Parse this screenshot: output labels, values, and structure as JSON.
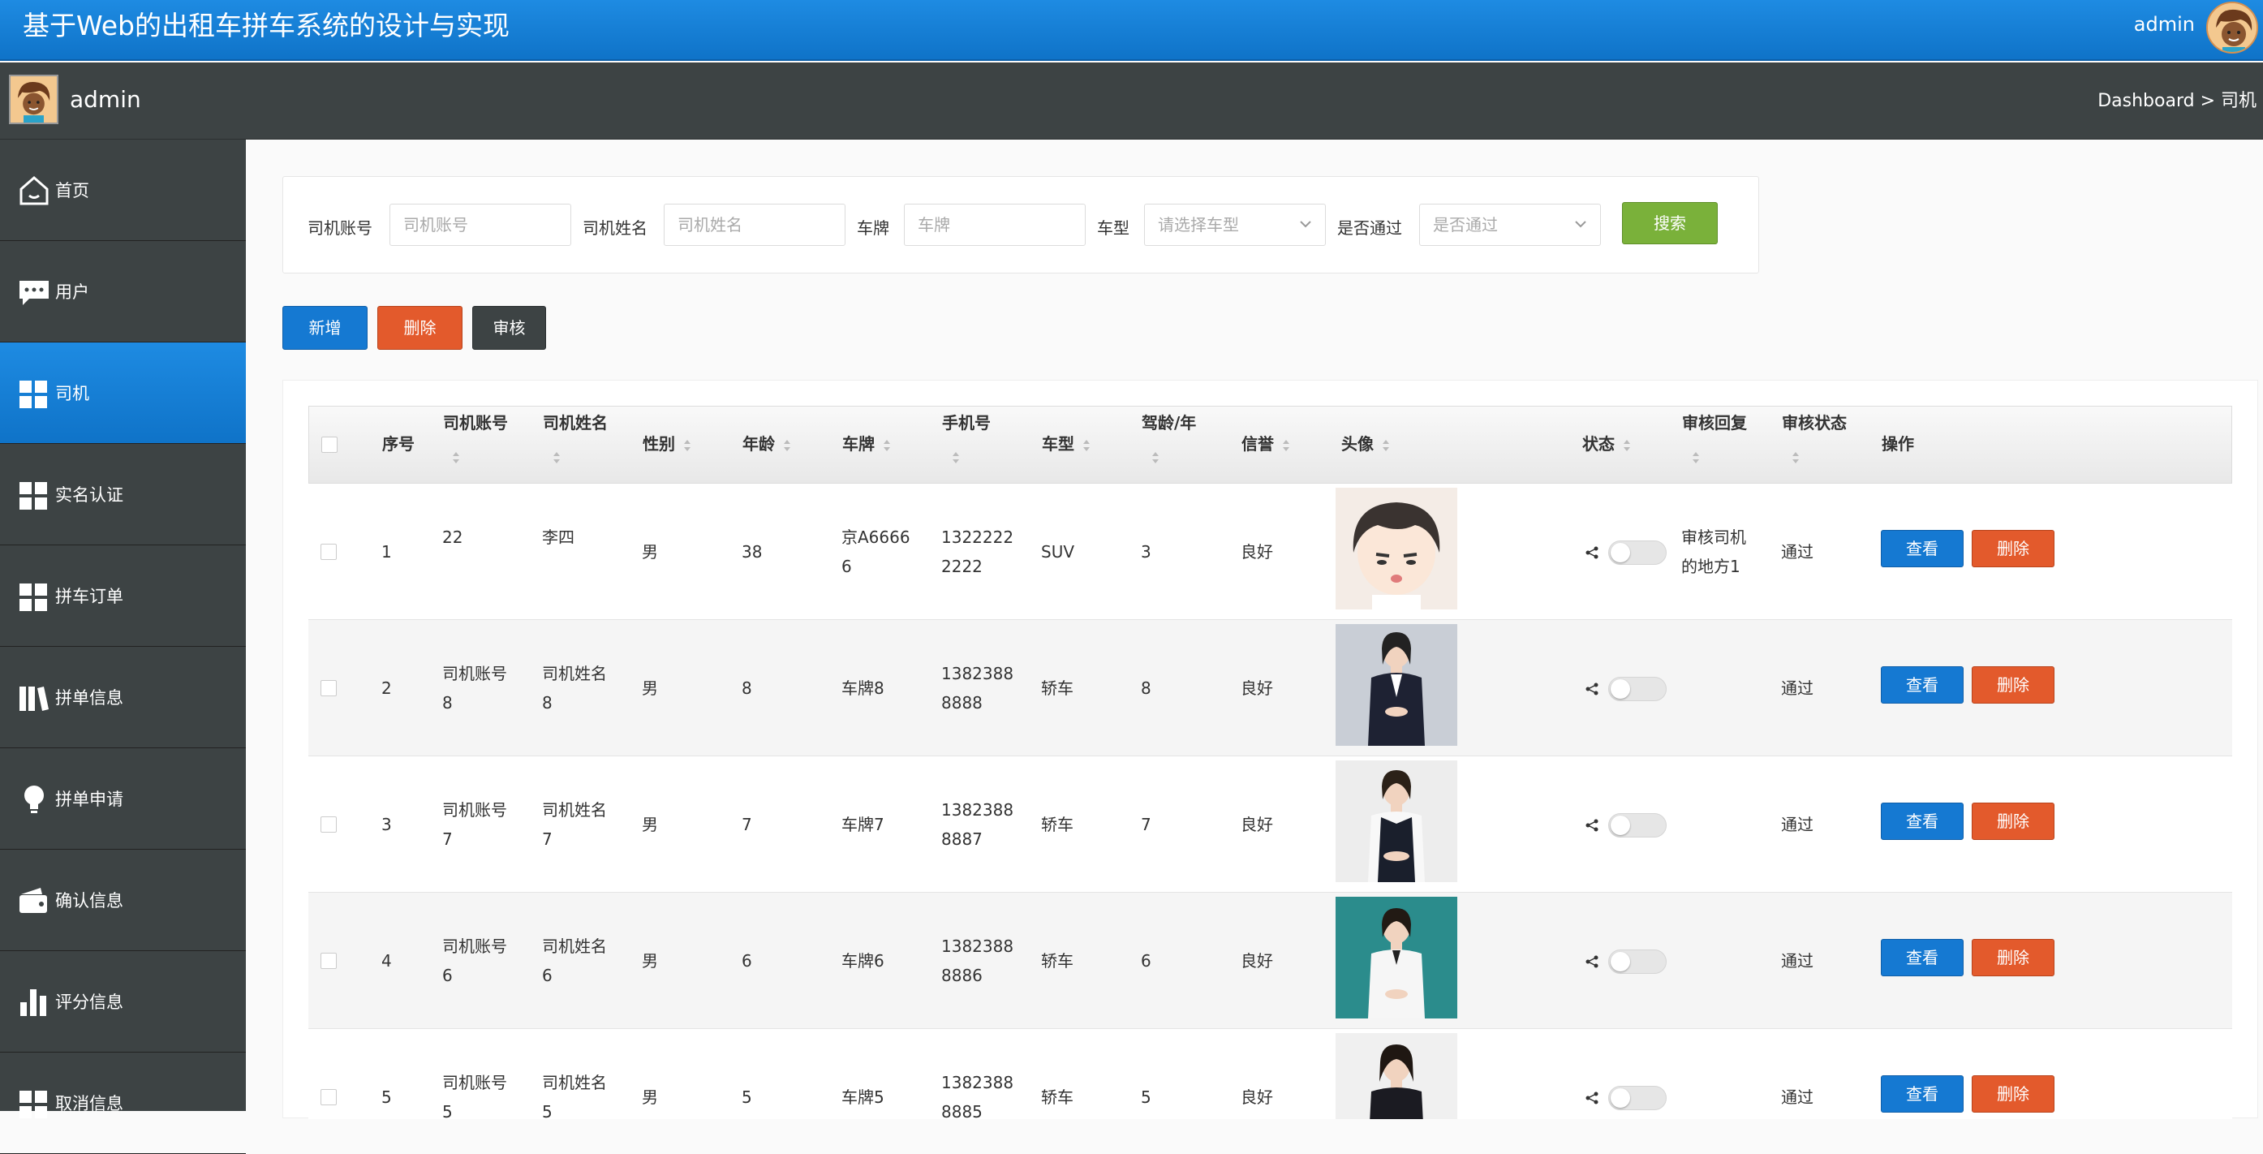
{
  "app": {
    "title": "基于Web的出租车拼车系统的设计与实现",
    "user": "admin"
  },
  "subbar": {
    "user": "admin",
    "breadcrumb": "Dashboard > 司机"
  },
  "sidebar": {
    "items": [
      {
        "label": "首页",
        "icon": "home-icon"
      },
      {
        "label": "用户",
        "icon": "chat-icon"
      },
      {
        "label": "司机",
        "icon": "grid-icon",
        "active": true
      },
      {
        "label": "实名认证",
        "icon": "grid-icon"
      },
      {
        "label": "拼车订单",
        "icon": "grid-icon"
      },
      {
        "label": "拼单信息",
        "icon": "book-icon"
      },
      {
        "label": "拼单申请",
        "icon": "bulb-icon"
      },
      {
        "label": "确认信息",
        "icon": "wallet-icon"
      },
      {
        "label": "评分信息",
        "icon": "bar-chart-icon"
      },
      {
        "label": "取消信息",
        "icon": "grid-icon"
      }
    ]
  },
  "search": {
    "account_label": "司机账号",
    "account_placeholder": "司机账号",
    "name_label": "司机姓名",
    "name_placeholder": "司机姓名",
    "plate_label": "车牌",
    "plate_placeholder": "车牌",
    "type_label": "车型",
    "type_placeholder": "请选择车型",
    "pass_label": "是否通过",
    "pass_placeholder": "是否通过",
    "search_button": "搜索"
  },
  "actions": {
    "add": "新增",
    "delete": "删除",
    "audit": "审核"
  },
  "table": {
    "headers": {
      "index": "序号",
      "account": "司机账号",
      "name": "司机姓名",
      "gender": "性别",
      "age": "年龄",
      "plate": "车牌",
      "phone": "手机号",
      "type": "车型",
      "years": "驾龄/年",
      "credit": "信誉",
      "avatar": "头像",
      "status": "状态",
      "reply": "审核回复",
      "audit": "审核状态",
      "ops": "操作"
    },
    "view_label": "查看",
    "delete_label": "删除",
    "rows": [
      {
        "index": "1",
        "account_l1": "22",
        "account_l2": "",
        "name_l1": "李四",
        "name_l2": "",
        "gender": "男",
        "age": "38",
        "plate_l1": "京A6666",
        "plate_l2": "6",
        "phone_l1": "1322222",
        "phone_l2": "2222",
        "type": "SUV",
        "years": "3",
        "credit": "良好",
        "reply_l1": "审核司机",
        "reply_l2": "的地方1",
        "audit": "通过",
        "photo": "cartoon-boy"
      },
      {
        "index": "2",
        "account_l1": "司机账号",
        "account_l2": "8",
        "name_l1": "司机姓名",
        "name_l2": "8",
        "gender": "男",
        "age": "8",
        "plate_l1": "车牌8",
        "plate_l2": "",
        "phone_l1": "1382388",
        "phone_l2": "8888",
        "type": "轿车",
        "years": "8",
        "credit": "良好",
        "reply_l1": "",
        "reply_l2": "",
        "audit": "通过",
        "photo": "woman-dark-suit"
      },
      {
        "index": "3",
        "account_l1": "司机账号",
        "account_l2": "7",
        "name_l1": "司机姓名",
        "name_l2": "7",
        "gender": "男",
        "age": "7",
        "plate_l1": "车牌7",
        "plate_l2": "",
        "phone_l1": "1382388",
        "phone_l2": "8887",
        "type": "轿车",
        "years": "7",
        "credit": "良好",
        "reply_l1": "",
        "reply_l2": "",
        "audit": "通过",
        "photo": "woman-vest"
      },
      {
        "index": "4",
        "account_l1": "司机账号",
        "account_l2": "6",
        "name_l1": "司机姓名",
        "name_l2": "6",
        "gender": "男",
        "age": "6",
        "plate_l1": "车牌6",
        "plate_l2": "",
        "phone_l1": "1382388",
        "phone_l2": "8886",
        "type": "轿车",
        "years": "6",
        "credit": "良好",
        "reply_l1": "",
        "reply_l2": "",
        "audit": "通过",
        "photo": "woman-teal"
      },
      {
        "index": "5",
        "account_l1": "司机账号",
        "account_l2": "5",
        "name_l1": "司机姓名",
        "name_l2": "5",
        "gender": "男",
        "age": "5",
        "plate_l1": "车牌5",
        "plate_l2": "",
        "phone_l1": "1382388",
        "phone_l2": "8885",
        "type": "轿车",
        "years": "5",
        "credit": "良好",
        "reply_l1": "",
        "reply_l2": "",
        "audit": "通过",
        "photo": "woman-suit"
      }
    ]
  },
  "colors": {
    "primary": "#1579d2",
    "danger": "#e35a2c",
    "success": "#7ab13a",
    "dark": "#3d4344"
  }
}
